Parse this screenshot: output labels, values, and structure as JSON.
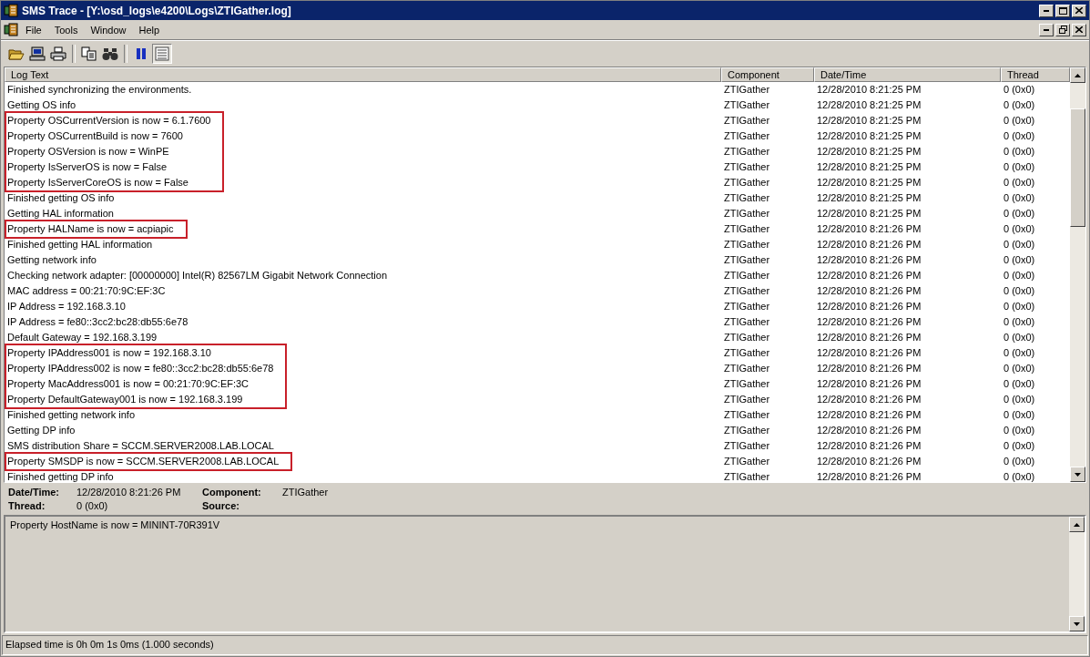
{
  "window": {
    "title": "SMS Trace - [Y:\\osd_logs\\e4200\\Logs\\ZTIGather.log]"
  },
  "menu": [
    "File",
    "Tools",
    "Window",
    "Help"
  ],
  "toolbar": [
    {
      "kind": "open",
      "pressed": false
    },
    {
      "kind": "computer",
      "pressed": false
    },
    {
      "kind": "print",
      "pressed": false
    },
    {
      "kind": "copy",
      "pressed": false
    },
    {
      "kind": "find",
      "pressed": false
    },
    {
      "kind": "pause",
      "pressed": false
    },
    {
      "kind": "details",
      "pressed": true
    }
  ],
  "table": {
    "columns": [
      "Log Text",
      "Component",
      "Date/Time",
      "Thread"
    ],
    "rows": [
      {
        "text": "Finished synchronizing the environments.",
        "component": "ZTIGather",
        "datetime": "12/28/2010 8:21:25 PM",
        "thread": "0 (0x0)",
        "highlighted": false
      },
      {
        "text": "Getting OS info",
        "component": "ZTIGather",
        "datetime": "12/28/2010 8:21:25 PM",
        "thread": "0 (0x0)",
        "highlighted": false
      },
      {
        "text": "Property OSCurrentVersion is now = 6.1.7600",
        "component": "ZTIGather",
        "datetime": "12/28/2010 8:21:25 PM",
        "thread": "0 (0x0)",
        "highlighted": true
      },
      {
        "text": "Property OSCurrentBuild is now = 7600",
        "component": "ZTIGather",
        "datetime": "12/28/2010 8:21:25 PM",
        "thread": "0 (0x0)",
        "highlighted": true
      },
      {
        "text": "Property OSVersion is now = WinPE",
        "component": "ZTIGather",
        "datetime": "12/28/2010 8:21:25 PM",
        "thread": "0 (0x0)",
        "highlighted": true
      },
      {
        "text": "Property IsServerOS is now = False",
        "component": "ZTIGather",
        "datetime": "12/28/2010 8:21:25 PM",
        "thread": "0 (0x0)",
        "highlighted": true
      },
      {
        "text": "Property IsServerCoreOS is now = False",
        "component": "ZTIGather",
        "datetime": "12/28/2010 8:21:25 PM",
        "thread": "0 (0x0)",
        "highlighted": true
      },
      {
        "text": "Finished getting OS info",
        "component": "ZTIGather",
        "datetime": "12/28/2010 8:21:25 PM",
        "thread": "0 (0x0)",
        "highlighted": false
      },
      {
        "text": "Getting HAL information",
        "component": "ZTIGather",
        "datetime": "12/28/2010 8:21:25 PM",
        "thread": "0 (0x0)",
        "highlighted": false
      },
      {
        "text": "Property HALName is now = acpiapic",
        "component": "ZTIGather",
        "datetime": "12/28/2010 8:21:26 PM",
        "thread": "0 (0x0)",
        "highlighted": true
      },
      {
        "text": "Finished getting HAL information",
        "component": "ZTIGather",
        "datetime": "12/28/2010 8:21:26 PM",
        "thread": "0 (0x0)",
        "highlighted": false
      },
      {
        "text": "Getting network info",
        "component": "ZTIGather",
        "datetime": "12/28/2010 8:21:26 PM",
        "thread": "0 (0x0)",
        "highlighted": false
      },
      {
        "text": "Checking network adapter: [00000000] Intel(R) 82567LM Gigabit Network Connection",
        "component": "ZTIGather",
        "datetime": "12/28/2010 8:21:26 PM",
        "thread": "0 (0x0)",
        "highlighted": false
      },
      {
        "text": "MAC address = 00:21:70:9C:EF:3C",
        "component": "ZTIGather",
        "datetime": "12/28/2010 8:21:26 PM",
        "thread": "0 (0x0)",
        "highlighted": false
      },
      {
        "text": "IP Address = 192.168.3.10",
        "component": "ZTIGather",
        "datetime": "12/28/2010 8:21:26 PM",
        "thread": "0 (0x0)",
        "highlighted": false
      },
      {
        "text": "IP Address = fe80::3cc2:bc28:db55:6e78",
        "component": "ZTIGather",
        "datetime": "12/28/2010 8:21:26 PM",
        "thread": "0 (0x0)",
        "highlighted": false
      },
      {
        "text": "Default Gateway = 192.168.3.199",
        "component": "ZTIGather",
        "datetime": "12/28/2010 8:21:26 PM",
        "thread": "0 (0x0)",
        "highlighted": false
      },
      {
        "text": "Property IPAddress001 is now = 192.168.3.10",
        "component": "ZTIGather",
        "datetime": "12/28/2010 8:21:26 PM",
        "thread": "0 (0x0)",
        "highlighted": true
      },
      {
        "text": "Property IPAddress002 is now = fe80::3cc2:bc28:db55:6e78",
        "component": "ZTIGather",
        "datetime": "12/28/2010 8:21:26 PM",
        "thread": "0 (0x0)",
        "highlighted": true
      },
      {
        "text": "Property MacAddress001 is now = 00:21:70:9C:EF:3C",
        "component": "ZTIGather",
        "datetime": "12/28/2010 8:21:26 PM",
        "thread": "0 (0x0)",
        "highlighted": true
      },
      {
        "text": "Property DefaultGateway001 is now = 192.168.3.199",
        "component": "ZTIGather",
        "datetime": "12/28/2010 8:21:26 PM",
        "thread": "0 (0x0)",
        "highlighted": true
      },
      {
        "text": "Finished getting network info",
        "component": "ZTIGather",
        "datetime": "12/28/2010 8:21:26 PM",
        "thread": "0 (0x0)",
        "highlighted": false
      },
      {
        "text": "Getting DP info",
        "component": "ZTIGather",
        "datetime": "12/28/2010 8:21:26 PM",
        "thread": "0 (0x0)",
        "highlighted": false
      },
      {
        "text": "SMS distribution Share = SCCM.SERVER2008.LAB.LOCAL",
        "component": "ZTIGather",
        "datetime": "12/28/2010 8:21:26 PM",
        "thread": "0 (0x0)",
        "highlighted": false
      },
      {
        "text": "Property SMSDP is now = SCCM.SERVER2008.LAB.LOCAL",
        "component": "ZTIGather",
        "datetime": "12/28/2010 8:21:26 PM",
        "thread": "0 (0x0)",
        "highlighted": true
      },
      {
        "text": "Finished getting DP info",
        "component": "ZTIGather",
        "datetime": "12/28/2010 8:21:26 PM",
        "thread": "0 (0x0)",
        "highlighted": false
      }
    ]
  },
  "details": {
    "datetime_label": "Date/Time:",
    "datetime": "12/28/2010 8:21:26 PM",
    "component_label": "Component:",
    "component": "ZTIGather",
    "thread_label": "Thread:",
    "thread": "0 (0x0)",
    "source_label": "Source:"
  },
  "message": "Property HostName is now = MININT-70R391V",
  "status_bar": "Elapsed time is 0h 0m 1s 0ms (1.000 seconds)"
}
